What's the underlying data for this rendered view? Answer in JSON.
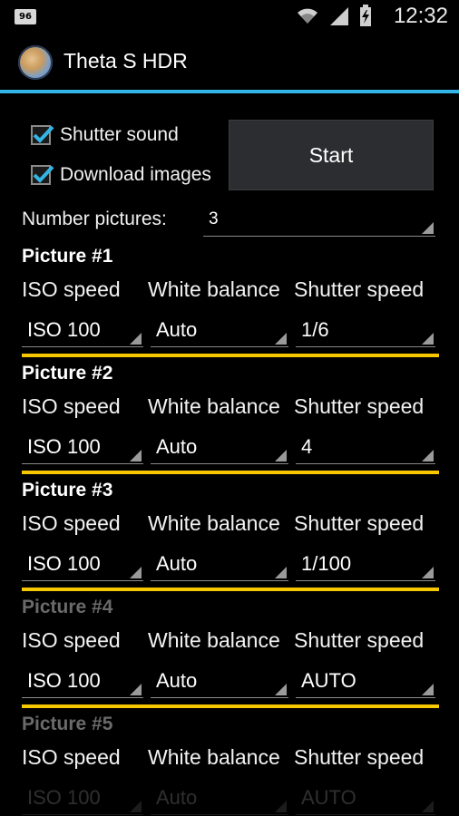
{
  "status_bar": {
    "notification_badge": "96",
    "time": "12:32",
    "icons": [
      "wifi-icon",
      "signal-icon",
      "battery-charging-icon"
    ]
  },
  "app": {
    "title": "Theta S HDR",
    "icon": "app-icon"
  },
  "settings": {
    "shutter_sound": {
      "label": "Shutter sound",
      "checked": true
    },
    "download_images": {
      "label": "Download images",
      "checked": true
    },
    "start_label": "Start",
    "number_pictures_label": "Number pictures:",
    "number_pictures_value": "3"
  },
  "columns": {
    "iso": "ISO speed",
    "white_balance": "White balance",
    "shutter": "Shutter speed"
  },
  "pictures": [
    {
      "title": "Picture #1",
      "iso": "ISO 100",
      "white_balance": "Auto",
      "shutter": "1/6",
      "enabled": true
    },
    {
      "title": "Picture #2",
      "iso": "ISO 100",
      "white_balance": "Auto",
      "shutter": "4",
      "enabled": true
    },
    {
      "title": "Picture #3",
      "iso": "ISO 100",
      "white_balance": "Auto",
      "shutter": "1/100",
      "enabled": true
    },
    {
      "title": "Picture #4",
      "iso": "ISO 100",
      "white_balance": "Auto",
      "shutter": "AUTO",
      "enabled": false
    },
    {
      "title": "Picture #5",
      "iso": "ISO 100",
      "white_balance": "Auto",
      "shutter": "AUTO",
      "enabled": false
    }
  ],
  "colors": {
    "accent": "#33b5e5",
    "separator": "#f7c800",
    "check": "#33b5e5"
  }
}
